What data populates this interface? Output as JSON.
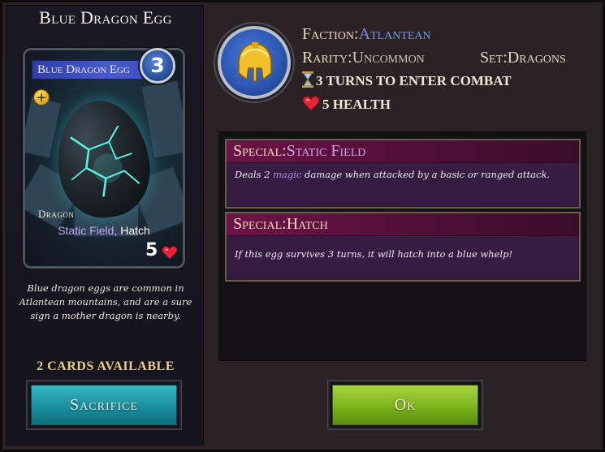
{
  "card": {
    "title": "Blue Dragon Egg",
    "name_bar": "Blue Dragon Egg",
    "cost": "3",
    "plus_badge": "+",
    "type": "Dragon",
    "abilities_magic": "Static Field,",
    "abilities_rest": " Hatch",
    "health": "5",
    "description": "Blue dragon eggs are common in Atlantean mountains, and are a sure sign a mother dragon is nearby.",
    "cards_available": "2 CARDS AVAILABLE"
  },
  "buttons": {
    "sacrifice": "Sacrifice",
    "ok": "Ok"
  },
  "meta": {
    "faction_label": "Faction:",
    "faction_value": "Atlantean",
    "rarity_label": "Rarity:",
    "rarity_value": "Uncommon",
    "set_label": "Set:",
    "set_value": "Dragons",
    "turns": "3 TURNS TO ENTER COMBAT",
    "health": "5 HEALTH"
  },
  "abilities": [
    {
      "prefix": "Special:",
      "name": "Static Field",
      "desc_before": "Deals 2 ",
      "desc_magic": "magic",
      "desc_after": " damage when attacked by a basic or ranged attack."
    },
    {
      "prefix": "Special:",
      "name": "Hatch",
      "desc": "If this egg survives 3 turns, it will hatch into a blue whelp!"
    }
  ],
  "icons": {
    "faction": "golden-helmet-icon",
    "turns": "hourglass-icon",
    "health": "heart-icon"
  },
  "colors": {
    "faction_blue": "#6f93e8",
    "magic_purple": "#b48cf0",
    "sacrifice_teal": "#1b8e9e",
    "ok_green": "#7bb41b",
    "ability_header": "#6c1448"
  }
}
